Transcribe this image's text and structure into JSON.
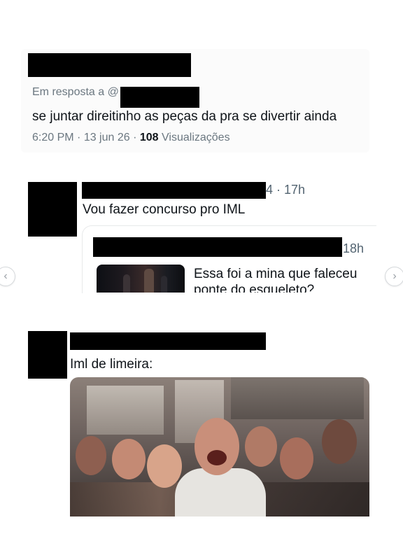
{
  "tweet1": {
    "reply_prefix": "Em resposta a @",
    "text": "se juntar direitinho as peças da pra se divertir ainda",
    "time": "6:20 PM",
    "date": "13 jun 26",
    "views_count": "108",
    "views_label": "Visualizações",
    "separator": " · "
  },
  "tweet2": {
    "time_fragment": "4 · 17h",
    "text": "Vou fazer concurso pro IML",
    "quote": {
      "time": "18h",
      "line1": "Essa foi a mina que faleceu",
      "line2": "ponte do esqueleto?"
    }
  },
  "tweet3": {
    "text": "Iml de limeira:"
  },
  "carousel": {
    "prev_icon": "‹",
    "next_icon": "›"
  }
}
